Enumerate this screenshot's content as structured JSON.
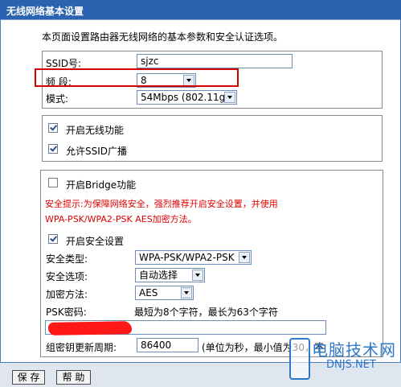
{
  "title": "无线网络基本设置",
  "description": "本页面设置路由器无线网络的基本参数和安全认证选项。",
  "basic": {
    "ssid_label": "SSID号:",
    "ssid_value": "sjzc",
    "channel_label": "频  段:",
    "channel_value": "8",
    "mode_label": "模式:",
    "mode_value": "54Mbps (802.11g)"
  },
  "wireless": {
    "enable_label": "开启无线功能",
    "enable_checked": true,
    "ssid_broadcast_label": "允许SSID广播",
    "ssid_broadcast_checked": true
  },
  "security": {
    "bridge_label": "开启Bridge功能",
    "bridge_checked": false,
    "warning_line1": "安全提示:为保障网络安全，强烈推荐开启安全设置，并使用",
    "warning_line2": "WPA-PSK/WPA2-PSK AES加密方法。",
    "enable_security_label": "开启安全设置",
    "enable_security_checked": true,
    "type_label": "安全类型:",
    "type_value": "WPA-PSK/WPA2-PSK",
    "option_label": "安全选项:",
    "option_value": "自动选择",
    "encryption_label": "加密方法:",
    "encryption_value": "AES",
    "psk_label": "PSK密码:",
    "psk_hint": "最短为8个字符，最长为63个字符",
    "psk_value": "",
    "rekey_label": "组密钥更新周期:",
    "rekey_value": "86400",
    "rekey_hint": "(单位为秒，最小值为30，不"
  },
  "buttons": {
    "save": "保 存",
    "help": "帮 助"
  },
  "watermark": {
    "line1": "电脑技术网",
    "line2": "DNJS.NET"
  },
  "colors": {
    "title_bar": "#2a63b0",
    "warning_text": "#e00000",
    "highlight_box": "#d40000",
    "watermark": "#2f78c8"
  }
}
